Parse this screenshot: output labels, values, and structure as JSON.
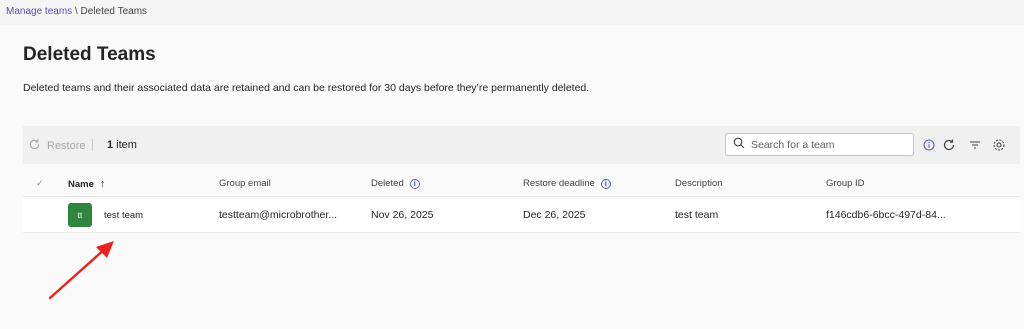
{
  "breadcrumb": {
    "parent": "Manage teams",
    "separator": " \\ ",
    "current": "Deleted Teams"
  },
  "page": {
    "title": "Deleted Teams",
    "description": "Deleted teams and their associated data are retained and can be restored for 30 days before they’re permanently deleted."
  },
  "toolbar": {
    "restore_label": "Restore",
    "count_number": "1",
    "count_suffix": " item",
    "search_placeholder": "Search for a team"
  },
  "table": {
    "headers": {
      "name": "Name",
      "group_email": "Group email",
      "deleted": "Deleted",
      "restore_deadline": "Restore deadline",
      "description": "Description",
      "group_id": "Group ID"
    },
    "rows": [
      {
        "avatar": "tt",
        "name": "test team",
        "group_email": "testteam@microbrother...",
        "deleted": "Nov 26, 2025",
        "restore_deadline": "Dec 26, 2025",
        "description": "test team",
        "group_id": "f146cdb6-6bcc-497d-84..."
      }
    ]
  },
  "colors": {
    "accent": "#5b5fc7",
    "avatar_bg": "#2e8540",
    "annotation_arrow": "#e8231b"
  },
  "icons": [
    "restore-icon",
    "search-icon",
    "info-icon",
    "refresh-icon",
    "filter-icon",
    "settings-icon",
    "checkmark-icon",
    "sort-arrow-up-icon"
  ]
}
